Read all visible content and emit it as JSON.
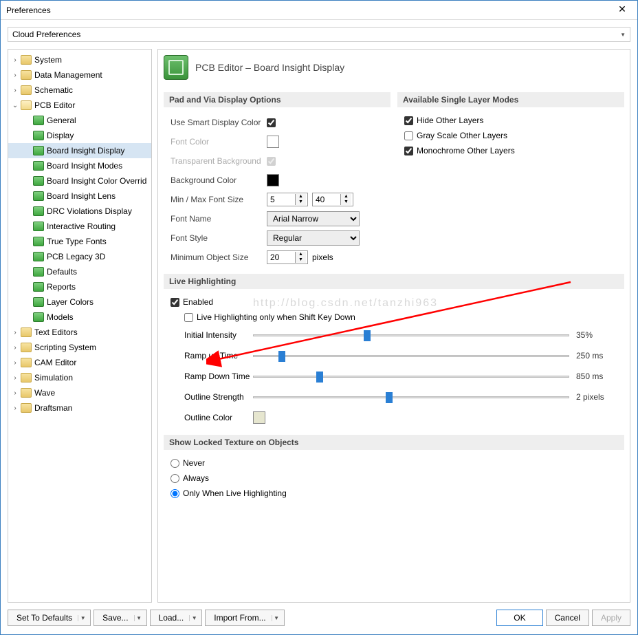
{
  "window": {
    "title": "Preferences"
  },
  "cloud": {
    "label": "Cloud Preferences"
  },
  "tree": {
    "top": [
      {
        "label": "System",
        "expanded": false
      },
      {
        "label": "Data Management",
        "expanded": false
      },
      {
        "label": "Schematic",
        "expanded": false
      }
    ],
    "pcb": {
      "label": "PCB Editor",
      "expanded": true,
      "children": [
        "General",
        "Display",
        "Board Insight Display",
        "Board Insight Modes",
        "Board Insight Color Overrid",
        "Board Insight Lens",
        "DRC Violations Display",
        "Interactive Routing",
        "True Type Fonts",
        "PCB Legacy 3D",
        "Defaults",
        "Reports",
        "Layer Colors",
        "Models"
      ],
      "selected_index": 2
    },
    "bottom": [
      {
        "label": "Text Editors"
      },
      {
        "label": "Scripting System"
      },
      {
        "label": "CAM Editor"
      },
      {
        "label": "Simulation"
      },
      {
        "label": "Wave"
      },
      {
        "label": "Draftsman"
      }
    ]
  },
  "header": {
    "title": "PCB Editor – Board Insight Display"
  },
  "sections": {
    "pad": {
      "title": "Pad and Via Display Options",
      "use_smart": "Use Smart Display Color",
      "use_smart_checked": true,
      "font_color": "Font Color",
      "font_color_hex": "#ffffff",
      "transparent": "Transparent Background",
      "transparent_checked": true,
      "background": "Background Color",
      "background_hex": "#000000",
      "minmax": "Min / Max Font Size",
      "min": "5",
      "max": "40",
      "fontname_lbl": "Font Name",
      "fontname": "Arial Narrow",
      "fontstyle_lbl": "Font Style",
      "fontstyle": "Regular",
      "minobj_lbl": "Minimum Object Size",
      "minobj": "20",
      "minobj_unit": "pixels"
    },
    "layers": {
      "title": "Available Single Layer Modes",
      "hide": "Hide Other Layers",
      "hide_checked": true,
      "gray": "Gray Scale Other Layers",
      "gray_checked": false,
      "mono": "Monochrome Other Layers",
      "mono_checked": true
    },
    "live": {
      "title": "Live Highlighting",
      "enabled": "Enabled",
      "enabled_checked": true,
      "shift": "Live Highlighting only when Shift Key Down",
      "shift_checked": false,
      "rows": [
        {
          "label": "Initial Intensity",
          "value": "35%",
          "pos": 35
        },
        {
          "label": "Ramp up Time",
          "value": "250 ms",
          "pos": 8
        },
        {
          "label": "Ramp Down Time",
          "value": "850 ms",
          "pos": 20
        },
        {
          "label": "Outline Strength",
          "value": "2 pixels",
          "pos": 42
        }
      ],
      "outline_color_lbl": "Outline Color",
      "outline_color_hex": "#e6e6cf"
    },
    "locked": {
      "title": "Show Locked Texture on Objects",
      "options": [
        "Never",
        "Always",
        "Only When Live Highlighting"
      ],
      "selected": 2
    }
  },
  "watermark": "http://blog.csdn.net/tanzhi963",
  "buttons": {
    "set": "Set To Defaults",
    "save": "Save...",
    "load": "Load...",
    "import": "Import From...",
    "ok": "OK",
    "cancel": "Cancel",
    "apply": "Apply"
  }
}
